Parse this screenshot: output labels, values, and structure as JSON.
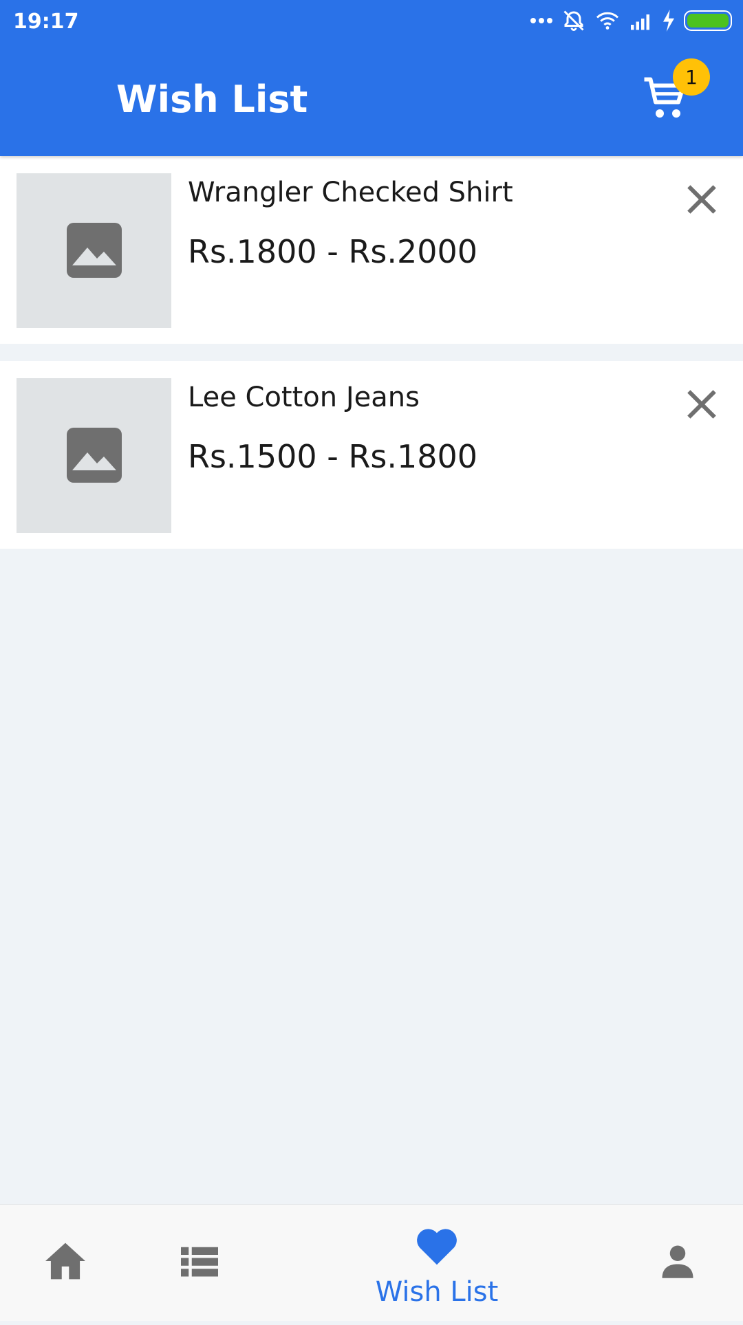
{
  "status_bar": {
    "time": "19:17",
    "icons": [
      "more-dots-icon",
      "alarm-off-icon",
      "wifi-icon",
      "signal-icon",
      "charging-icon",
      "battery-icon"
    ]
  },
  "header": {
    "title": "Wish List",
    "cart_count": "1",
    "cart_icon": "shopping-cart-icon",
    "badge_color": "#ffc107"
  },
  "wishlist": {
    "items": [
      {
        "name": "Wrangler Checked Shirt",
        "price": "Rs.1800 - Rs.2000",
        "image_icon": "image-placeholder-icon",
        "remove_icon": "close-icon"
      },
      {
        "name": "Lee Cotton Jeans",
        "price": "Rs.1500 - Rs.1800",
        "image_icon": "image-placeholder-icon",
        "remove_icon": "close-icon"
      }
    ]
  },
  "bottom_nav": {
    "items": [
      {
        "icon": "home-icon",
        "label": ""
      },
      {
        "icon": "list-icon",
        "label": ""
      },
      {
        "icon": "heart-icon",
        "label": "Wish List",
        "active": true
      },
      {
        "icon": "person-icon",
        "label": ""
      }
    ]
  },
  "theme": {
    "primary": "#2a72e8",
    "background": "#eff3f7",
    "icon_gray": "#6f6f6f"
  }
}
